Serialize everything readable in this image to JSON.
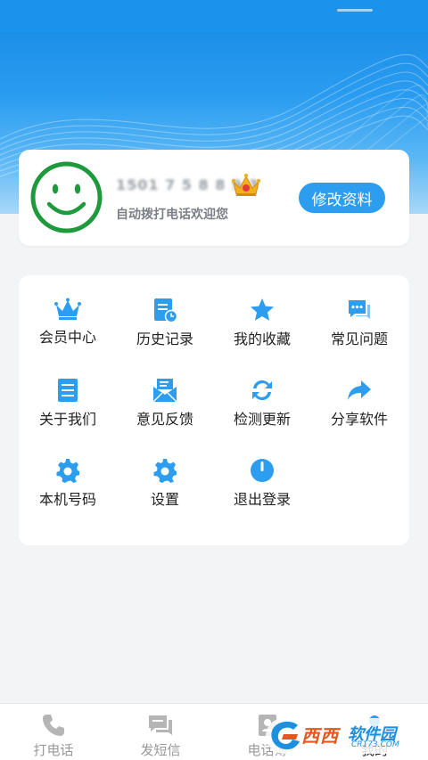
{
  "profile": {
    "phone": "1501 7 5 8 8 9 3",
    "welcome": "自动拨打电话欢迎您",
    "edit_label": "修改资料"
  },
  "menu": [
    {
      "label": "会员中心",
      "icon": "crown-icon"
    },
    {
      "label": "历史记录",
      "icon": "history-doc-icon"
    },
    {
      "label": "我的收藏",
      "icon": "star-icon"
    },
    {
      "label": "常见问题",
      "icon": "chat-bubbles-icon"
    },
    {
      "label": "关于我们",
      "icon": "document-list-icon"
    },
    {
      "label": "意见反馈",
      "icon": "mail-feedback-icon"
    },
    {
      "label": "检测更新",
      "icon": "refresh-icon"
    },
    {
      "label": "分享软件",
      "icon": "share-arrow-icon"
    },
    {
      "label": "本机号码",
      "icon": "gear-icon"
    },
    {
      "label": "设置",
      "icon": "gear-icon"
    },
    {
      "label": "退出登录",
      "icon": "power-icon"
    }
  ],
  "nav": [
    {
      "label": "打电话",
      "icon": "phone-icon"
    },
    {
      "label": "发短信",
      "icon": "message-icon"
    },
    {
      "label": "电话簿",
      "icon": "contacts-icon"
    },
    {
      "label": "我的",
      "icon": "user-icon"
    }
  ],
  "watermark": {
    "brand": "西西",
    "brand2": "软件园",
    "url": "CR173.COM"
  },
  "colors": {
    "accent": "#2d9df0",
    "banner": "#1a93ec",
    "smile": "#1e9a3c"
  }
}
